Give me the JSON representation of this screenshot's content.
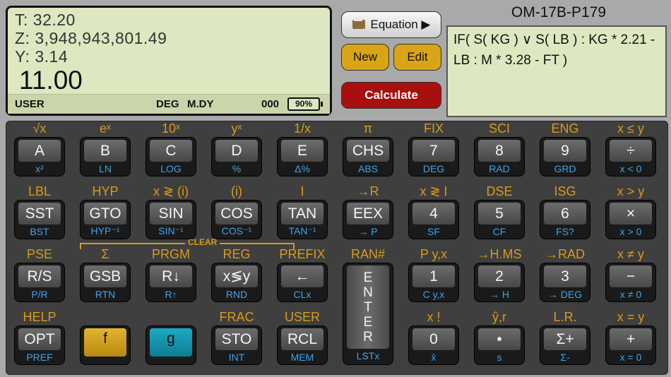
{
  "lcd": {
    "t": "T:  32.20",
    "z": "Z:  3,948,943,801.49",
    "y": "Y:  3.14",
    "x": "11.00",
    "mode": "USER",
    "angle": "DEG",
    "date_format": "M.DY",
    "flags": "000",
    "battery": "90%"
  },
  "buttons": {
    "equation": "Equation ▶",
    "new": "New",
    "edit": "Edit",
    "calculate": "Calculate"
  },
  "equation": {
    "title": "OM-17B-P179",
    "text": "IF( S( KG ) ∨ S( LB ) : KG * 2.21 - LB : M * 3.28 - FT )"
  },
  "clear_label": "CLEAR",
  "rows": [
    [
      {
        "f": "√x",
        "main": "A",
        "g": "x²"
      },
      {
        "f": "eˣ",
        "main": "B",
        "g": "LN"
      },
      {
        "f": "10ˣ",
        "main": "C",
        "g": "LOG"
      },
      {
        "f": "yˣ",
        "main": "D",
        "g": "%"
      },
      {
        "f": "1/x",
        "main": "E",
        "g": "Δ%"
      },
      {
        "f": "π",
        "main": "CHS",
        "g": "ABS"
      },
      {
        "f": "FIX",
        "main": "7",
        "g": "DEG"
      },
      {
        "f": "SCI",
        "main": "8",
        "g": "RAD"
      },
      {
        "f": "ENG",
        "main": "9",
        "g": "GRD"
      },
      {
        "f": "x ≤ y",
        "main": "÷",
        "g": "x < 0"
      }
    ],
    [
      {
        "f": "LBL",
        "main": "SST",
        "g": "BST"
      },
      {
        "f": "HYP",
        "main": "GTO",
        "g": "HYP⁻¹"
      },
      {
        "f": "x ≷ (i)",
        "main": "SIN",
        "g": "SIN⁻¹"
      },
      {
        "f": "(i)",
        "main": "COS",
        "g": "COS⁻¹"
      },
      {
        "f": "I",
        "main": "TAN",
        "g": "TAN⁻¹"
      },
      {
        "f": "→R",
        "main": "EEX",
        "g": "→ P"
      },
      {
        "f": "x ≷ I",
        "main": "4",
        "g": "SF"
      },
      {
        "f": "DSE",
        "main": "5",
        "g": "CF"
      },
      {
        "f": "ISG",
        "main": "6",
        "g": "FS?"
      },
      {
        "f": "x > y",
        "main": "×",
        "g": "x > 0"
      }
    ],
    [
      {
        "f": "PSE",
        "main": "R/S",
        "g": "P/R"
      },
      {
        "f": "Σ",
        "main": "GSB",
        "g": "RTN"
      },
      {
        "f": "PRGM",
        "main": "R↓",
        "g": "R↑"
      },
      {
        "f": "REG",
        "main": "x≶y",
        "g": "RND"
      },
      {
        "f": "PREFIX",
        "main": "←",
        "g": "CLx"
      },
      {
        "f": "RAN#",
        "main": "",
        "g": ""
      },
      {
        "f": "P y,x",
        "main": "1",
        "g": "C y,x"
      },
      {
        "f": "→H.MS",
        "main": "2",
        "g": "→ H"
      },
      {
        "f": "→RAD",
        "main": "3",
        "g": "→ DEG"
      },
      {
        "f": "x ≠ y",
        "main": "−",
        "g": "x ≠ 0"
      }
    ],
    [
      {
        "f": "HELP",
        "main": "OPT",
        "g": "PREF"
      },
      {
        "f": "",
        "main": "f",
        "g": ""
      },
      {
        "f": "",
        "main": "g",
        "g": ""
      },
      {
        "f": "FRAC",
        "main": "STO",
        "g": "INT"
      },
      {
        "f": "USER",
        "main": "RCL",
        "g": "MEM"
      },
      {
        "f": "",
        "main": "",
        "g": ""
      },
      {
        "f": "x !",
        "main": "0",
        "g": "x̄"
      },
      {
        "f": "ŷ,r",
        "main": "•",
        "g": "s"
      },
      {
        "f": "L.R.",
        "main": "Σ+",
        "g": "Σ-"
      },
      {
        "f": "x = y",
        "main": "+",
        "g": "x = 0"
      }
    ]
  ],
  "enter": {
    "letters": [
      "E",
      "N",
      "T",
      "E",
      "R"
    ],
    "g": "LSTx"
  }
}
